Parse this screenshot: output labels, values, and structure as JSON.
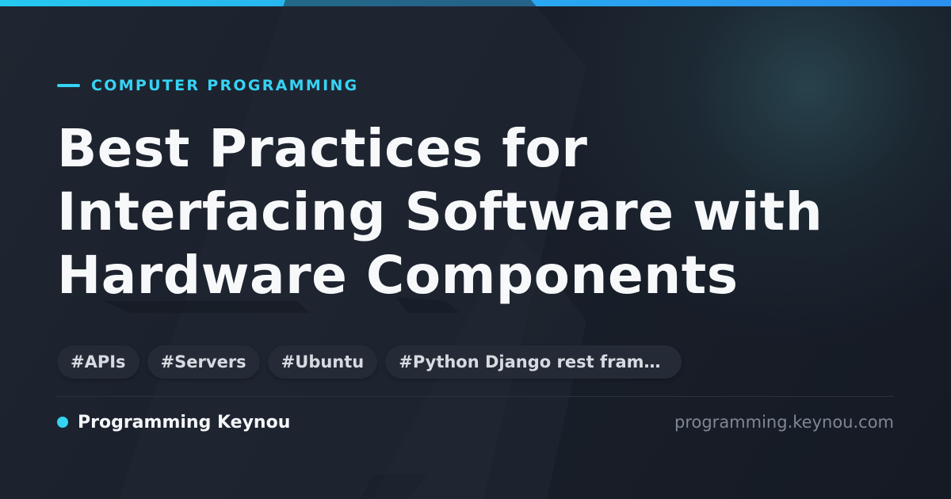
{
  "card": {
    "category": "COMPUTER PROGRAMMING",
    "title_lines": [
      "Best Practices for",
      "Interfacing Software with",
      "Hardware Components"
    ],
    "tags": [
      "#APIs",
      "#Servers",
      "#Ubuntu",
      "#Python Django rest framework"
    ],
    "brand": "Programming Keynou",
    "site_url": "programming.keynou.com"
  },
  "colors": {
    "accent": "#36d3f4",
    "background": "#171c26",
    "title": "#f7f8fa",
    "tag_background": "#242b36",
    "tag_text": "#d7dbe1",
    "url_text": "#7f8794"
  },
  "icons": {
    "category_marker": "dash",
    "brand_marker": "dot"
  }
}
